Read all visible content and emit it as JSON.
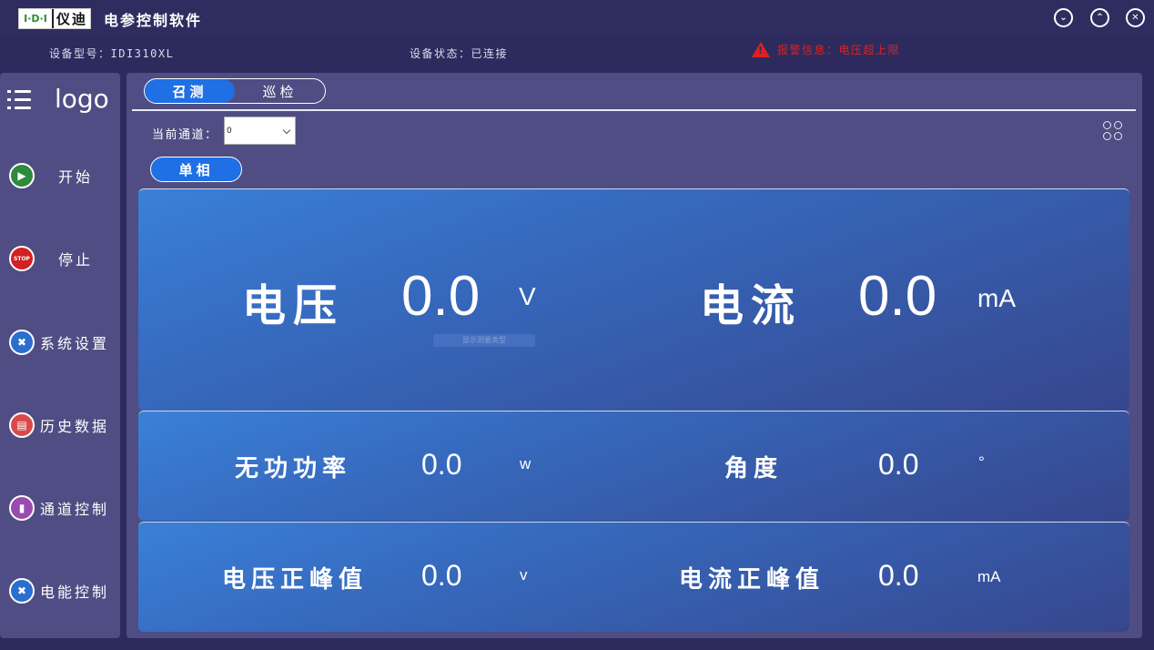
{
  "titlebar": {
    "logo_mark": "I·D·I",
    "logo_brand": "仪迪",
    "app_title": "电参控制软件",
    "buttons": [
      "minimize",
      "maximize",
      "close"
    ]
  },
  "infobar": {
    "model": "设备型号：IDI310XL",
    "status": "设备状态：已连接",
    "alarm": "报警信息：电压超上限"
  },
  "sidebar": {
    "logo": "logo",
    "items": [
      {
        "label": "开始",
        "icon": "play-icon"
      },
      {
        "label": "停止",
        "icon": "stop-icon",
        "icon_text": "STOP"
      },
      {
        "label": "系统设置",
        "icon": "tools-icon"
      },
      {
        "label": "历史数据",
        "icon": "folder-icon"
      },
      {
        "label": "通道控制",
        "icon": "signal-icon"
      },
      {
        "label": "电能控制",
        "icon": "tools-icon"
      }
    ]
  },
  "main": {
    "tabs": [
      {
        "label": "召测",
        "active": true
      },
      {
        "label": "巡检",
        "active": false
      }
    ],
    "channel_label": "当前通道：",
    "channel_value": "0",
    "phase_button": "单相",
    "tooltip": "显示测量类型"
  },
  "measurements": {
    "voltage": {
      "label": "电压",
      "value": "0.0",
      "unit": "V"
    },
    "current": {
      "label": "电流",
      "value": "0.0",
      "unit": "mA"
    },
    "reactive_power": {
      "label": "无功功率",
      "value": "0.0",
      "unit": "w"
    },
    "angle": {
      "label": "角度",
      "value": "0.0",
      "unit": "°"
    },
    "voltage_peak": {
      "label": "电压正峰值",
      "value": "0.0",
      "unit": "v"
    },
    "current_peak": {
      "label": "电流正峰值",
      "value": "0.0",
      "unit": "mA"
    }
  },
  "colors": {
    "background": "#2d2b5e",
    "panel": "#4f4d83",
    "accent": "#1f6fe5",
    "alarm": "#e02020",
    "card_top": "#3a80d8",
    "card_bottom": "#36468d"
  }
}
